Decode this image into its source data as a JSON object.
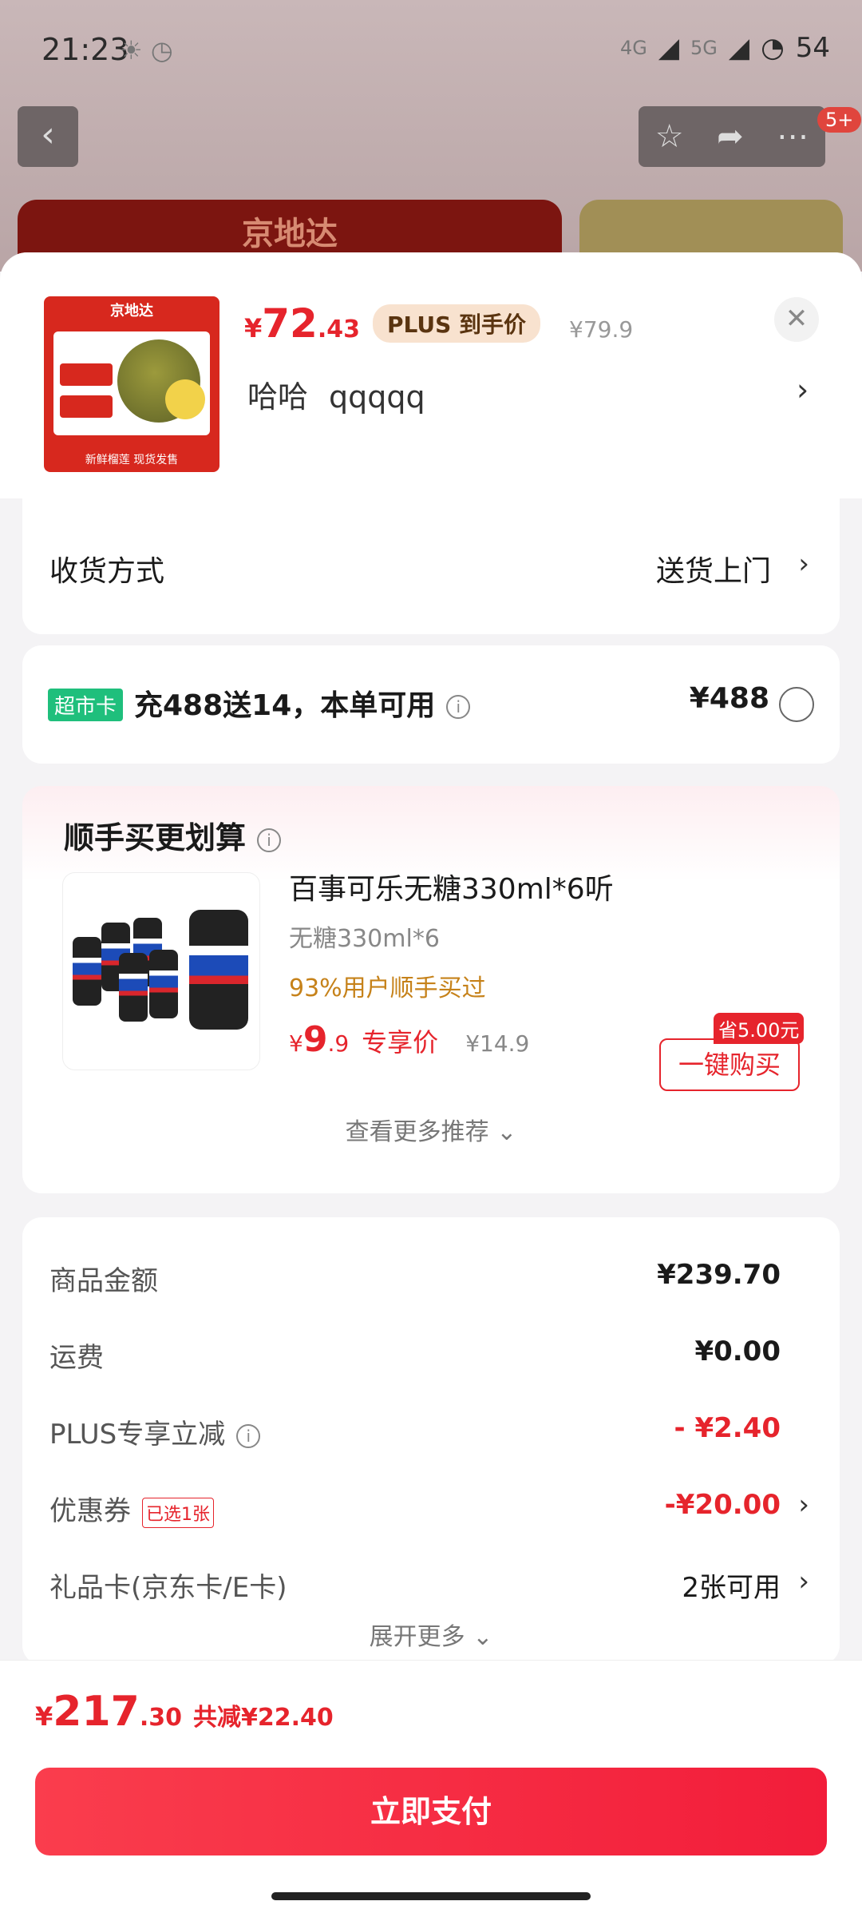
{
  "status": {
    "time": "21:23",
    "battery": "54",
    "net1": "4G",
    "net2": "5G"
  },
  "background": {
    "badge": "5+",
    "banner": "京地达"
  },
  "product": {
    "thumb_title": "京地达",
    "thumb_footer": "新鲜榴莲 现货发售",
    "price_currency": "¥",
    "price_int": "72",
    "price_dec": ".43",
    "plus_badge": "PLUS 到手价",
    "original_price": "¥79.9",
    "spec_1": "哈哈",
    "spec_2": "qqqqq"
  },
  "delivery": {
    "label": "收货方式",
    "value": "送货上门"
  },
  "supermarket": {
    "tag": "超市卡",
    "text": "充488送14，本单可用",
    "price": "¥488"
  },
  "recommend": {
    "title": "顺手买更划算",
    "name": "百事可乐无糖330ml*6听",
    "spec": "无糖330ml*6",
    "buyers": "93%用户顺手买过",
    "price_currency": "¥",
    "price_int": "9",
    "price_dec": ".9",
    "price_label": "专享价",
    "original_price": "¥14.9",
    "save_tag": "省5.00元",
    "buy_button": "一键购买",
    "more": "查看更多推荐 ⌄"
  },
  "summary": {
    "rows": [
      {
        "label": "商品金额",
        "value": "¥239.70"
      },
      {
        "label": "运费",
        "value": "¥0.00"
      },
      {
        "label": "PLUS专享立减",
        "value": "- ¥2.40"
      },
      {
        "label": "优惠券",
        "tag": "已选1张",
        "value": "-¥20.00"
      },
      {
        "label": "礼品卡(京东卡/E卡)",
        "value": "2张可用"
      }
    ],
    "expand": "展开更多 ⌄"
  },
  "footer": {
    "total_currency": "¥",
    "total_int": "217",
    "total_dec": ".30",
    "saved": "共减¥22.40",
    "pay_button": "立即支付"
  },
  "colors": {
    "accent_red": "#e6242c",
    "super_green": "#1fbf7c",
    "buyers_orange": "#c6821a"
  },
  "icons": [
    "back-icon",
    "star-icon",
    "share-icon",
    "more-icon",
    "close-icon",
    "info-icon",
    "chevron-right-icon",
    "radio-icon"
  ]
}
